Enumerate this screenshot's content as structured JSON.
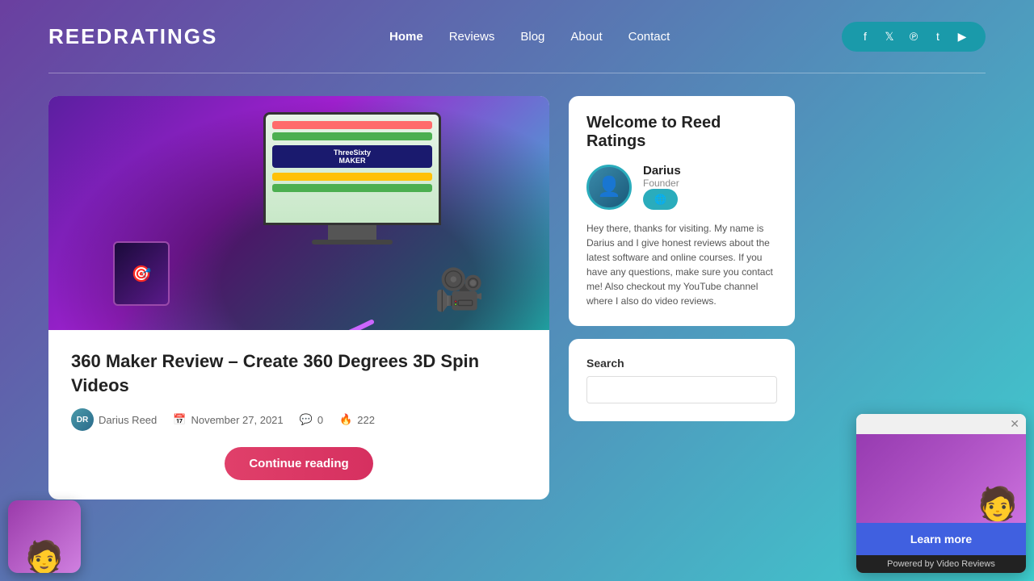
{
  "site": {
    "logo": "ReedRatings"
  },
  "nav": {
    "items": [
      {
        "label": "Home",
        "active": true
      },
      {
        "label": "Reviews",
        "active": false
      },
      {
        "label": "Blog",
        "active": false
      },
      {
        "label": "About",
        "active": false
      },
      {
        "label": "Contact",
        "active": false
      }
    ]
  },
  "social": {
    "icons": [
      "f",
      "t",
      "p",
      "T",
      "▶"
    ]
  },
  "article": {
    "title": "360 Maker Review – Create 360 Degrees 3D Spin Videos",
    "author": "Darius Reed",
    "date": "November 27, 2021",
    "comments": "0",
    "views": "222",
    "continue_label": "Continue reading"
  },
  "sidebar": {
    "welcome_title": "Welcome to Reed Ratings",
    "author_name": "Darius",
    "author_role": "Founder",
    "author_desc": "Hey there, thanks for visiting. My name is Darius and I give honest reviews about the latest software and online courses. If you have any questions, make sure you contact me! Also checkout my YouTube channel where I also do video reviews.",
    "search_label": "Search",
    "search_placeholder": ""
  },
  "video_widget": {
    "learn_more_label": "Learn more",
    "powered_by": "Powered by Video Reviews"
  }
}
